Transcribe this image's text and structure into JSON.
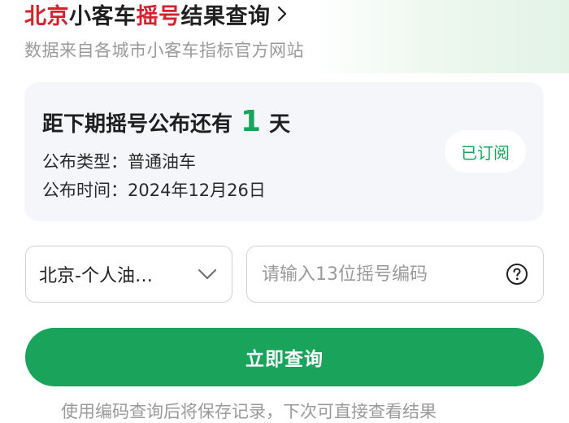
{
  "header": {
    "title_part1": "北京",
    "title_part2": "小客车",
    "title_part3": "摇号",
    "title_part4": "结果查询",
    "subtitle": "数据来自各城市小客车指标官方网站"
  },
  "card": {
    "countdown_prefix": "距下期摇号公布还有",
    "countdown_days": "1",
    "countdown_unit": "天",
    "type_line": "公布类型：普通油车",
    "time_line": "公布时间：2024年12月26日",
    "subscribe_label": "已订阅"
  },
  "form": {
    "category_value": "北京-个人油…",
    "code_placeholder": "请输入13位摇号编码",
    "query_label": "立即查询"
  },
  "footer": {
    "note": "使用编码查询后将保存记录，下次可直接查看结果"
  },
  "colors": {
    "brand_red": "#d6202e",
    "accent_green": "#1aa35a",
    "card_bg": "#f4f6f9"
  },
  "icons": {
    "title_chevron": "chevron-right-icon",
    "select_chevron": "chevron-down-icon",
    "help": "question-circle-icon"
  }
}
